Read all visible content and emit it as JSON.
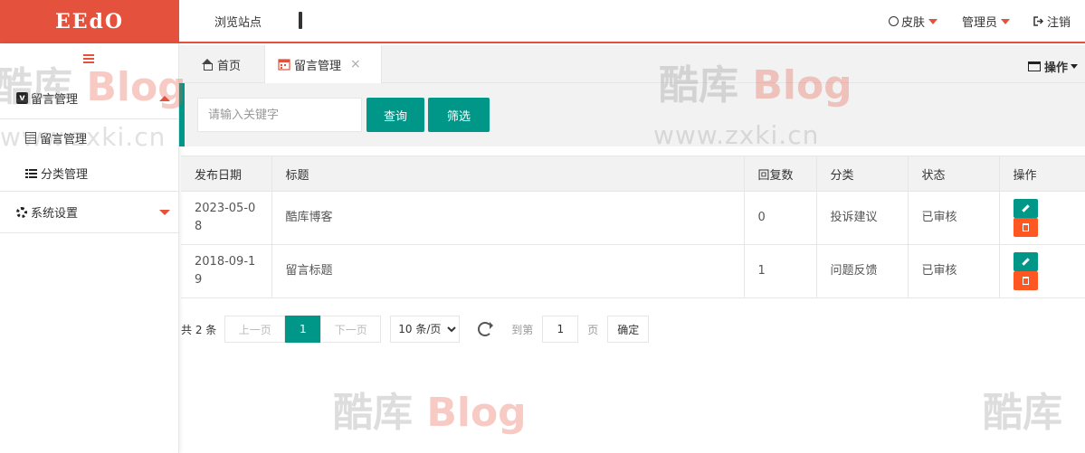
{
  "colors": {
    "brand": "#e4513c",
    "accent": "#009688",
    "danger": "#ff5722"
  },
  "logo": "EEdO",
  "header": {
    "browse_site": "浏览站点",
    "monitor_icon": "monitor-icon",
    "skin": "皮肤",
    "admin": "管理员",
    "logout": "注销"
  },
  "sidebar": {
    "toggle_icon": "hamburger-icon",
    "group1": {
      "label": "留言管理",
      "icon": "v-logo-icon",
      "expanded": true
    },
    "items": [
      {
        "label": "留言管理",
        "icon": "note-icon"
      },
      {
        "label": "分类管理",
        "icon": "list-icon"
      }
    ],
    "group2": {
      "label": "系统设置",
      "icon": "gear-icon",
      "expanded": false
    }
  },
  "tabs": {
    "home": "首页",
    "active": "留言管理",
    "close": "×",
    "operations": "操作"
  },
  "search": {
    "placeholder": "请输入关键字",
    "query_button": "查询",
    "filter_button": "筛选"
  },
  "table": {
    "headers": [
      "发布日期",
      "标题",
      "回复数",
      "分类",
      "状态",
      "操作"
    ],
    "rows": [
      {
        "date": "2023-05-08",
        "title": "酷库博客",
        "replies": "0",
        "category": "投诉建议",
        "status": "已审核"
      },
      {
        "date": "2018-09-19",
        "title": "留言标题",
        "replies": "1",
        "category": "问题反馈",
        "status": "已审核"
      }
    ]
  },
  "pagination": {
    "total": "共 2 条",
    "prev": "上一页",
    "current": "1",
    "next": "下一页",
    "page_size": "10 条/页",
    "goto_label": "到第",
    "goto_value": "1",
    "page_unit": "页",
    "confirm": "确定"
  },
  "watermark": {
    "cn": "酷库",
    "en": "Blog",
    "url": "www.zxki.cn"
  }
}
